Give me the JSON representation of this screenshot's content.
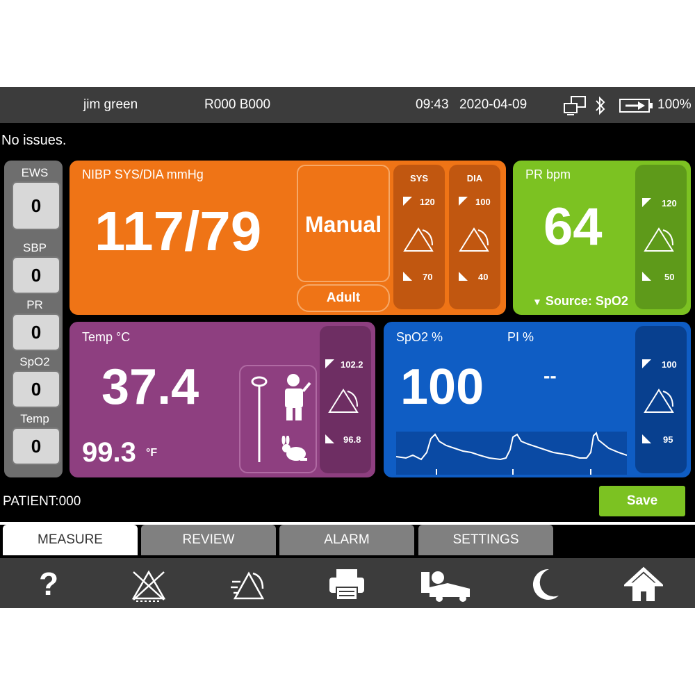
{
  "topbar": {
    "user": "jim green",
    "room": "R000 B000",
    "time": "09:43",
    "date": "2020-04-09",
    "battery": "100%"
  },
  "status": "No issues.",
  "ews": {
    "items": [
      {
        "label": "EWS",
        "value": "0"
      },
      {
        "label": "SBP",
        "value": "0"
      },
      {
        "label": "PR",
        "value": "0"
      },
      {
        "label": "SpO2",
        "value": "0"
      },
      {
        "label": "Temp",
        "value": "0"
      }
    ]
  },
  "nibp": {
    "label": "NIBP SYS/DIA mmHg",
    "value": "117/79",
    "mode": "Manual",
    "patient_type": "Adult",
    "sys": {
      "label": "SYS",
      "high": "120",
      "low": "70"
    },
    "dia": {
      "label": "DIA",
      "high": "100",
      "low": "40"
    },
    "color": "#ef7416"
  },
  "pr": {
    "label": "PR bpm",
    "value": "64",
    "source": "Source: SpO2",
    "high": "120",
    "low": "50",
    "color": "#7cc222"
  },
  "temp": {
    "label": "Temp °C",
    "value": "37.4",
    "value_f": "99.3",
    "unit_f": "°F",
    "high": "102.2",
    "low": "96.8",
    "color": "#8e3f80"
  },
  "spo2": {
    "label": "SpO2 %",
    "value": "100",
    "pi_label": "PI %",
    "pi_value": "--",
    "high": "100",
    "low": "95",
    "color": "#0f5dc4"
  },
  "patient": "PATIENT:000",
  "save_label": "Save",
  "tabs": [
    {
      "label": "MEASURE",
      "active": true
    },
    {
      "label": "REVIEW",
      "active": false
    },
    {
      "label": "ALARM",
      "active": false
    },
    {
      "label": "SETTINGS",
      "active": false
    }
  ],
  "icons": [
    "help-icon",
    "alarm-off-icon",
    "alarm-pause-icon",
    "printer-icon",
    "patient-bed-icon",
    "night-mode-icon",
    "home-icon"
  ]
}
